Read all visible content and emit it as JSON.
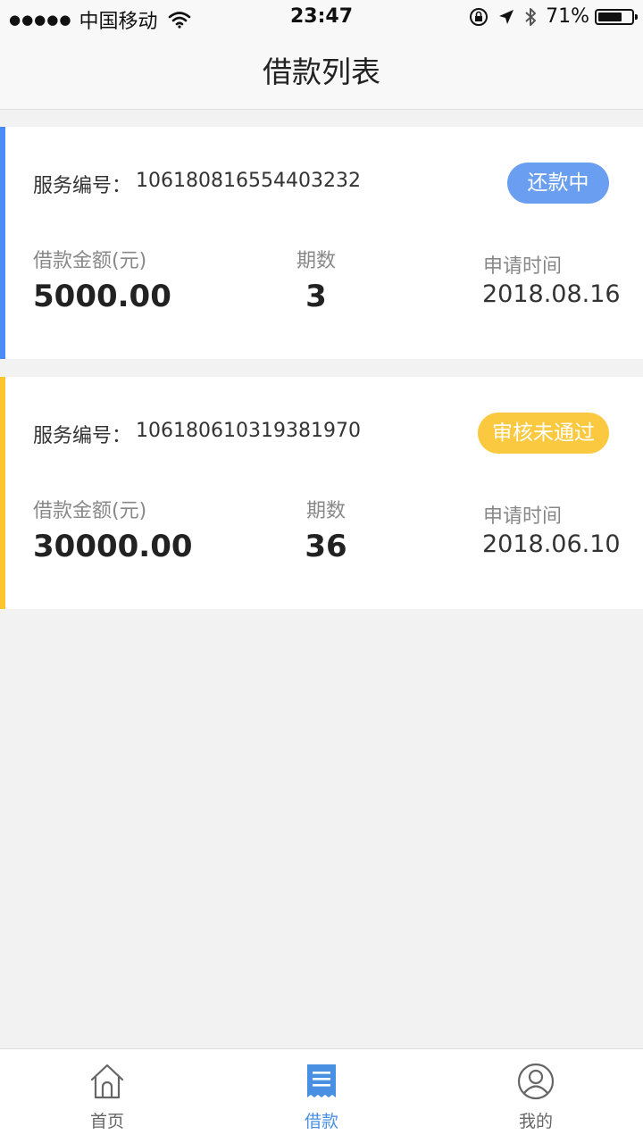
{
  "status_bar": {
    "signal": "●●●●●",
    "carrier": "中国移动",
    "time": "23:47",
    "battery_pct": "71%",
    "battery_level": 0.71
  },
  "header": {
    "title": "借款列表"
  },
  "loans": [
    {
      "service_label": "服务编号：",
      "service_no": "106180816554403232",
      "status": "还款中",
      "status_color": "#6a9ef0",
      "accent_color": "#4a8cf5",
      "amount_label": "借款金额(元)",
      "amount": "5000.00",
      "periods_label": "期数",
      "periods": "3",
      "date_label": "申请时间",
      "date": "2018.08.16"
    },
    {
      "service_label": "服务编号：",
      "service_no": "106180610319381970",
      "status": "审核未通过",
      "status_color": "#fbc93f",
      "accent_color": "#fcc52e",
      "amount_label": "借款金额(元)",
      "amount": "30000.00",
      "periods_label": "期数",
      "periods": "36",
      "date_label": "申请时间",
      "date": "2018.06.10"
    }
  ],
  "tabs": [
    {
      "label": "首页",
      "icon": "home-icon",
      "active": false
    },
    {
      "label": "借款",
      "icon": "receipt-icon",
      "active": true
    },
    {
      "label": "我的",
      "icon": "user-icon",
      "active": false
    }
  ],
  "colors": {
    "active_tab": "#4a90e2",
    "background": "#f2f2f2"
  }
}
